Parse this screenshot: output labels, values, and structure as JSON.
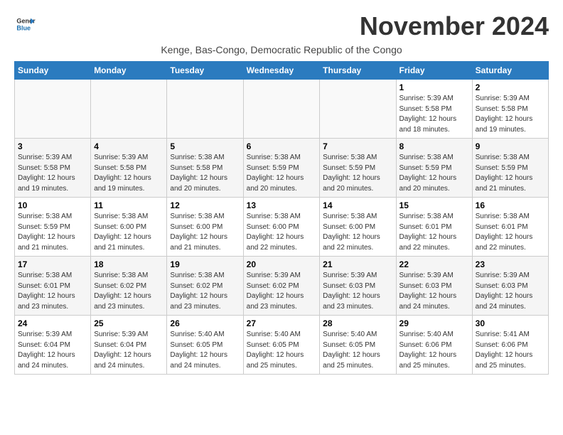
{
  "logo": {
    "line1": "General",
    "line2": "Blue"
  },
  "title": "November 2024",
  "subtitle": "Kenge, Bas-Congo, Democratic Republic of the Congo",
  "days_of_week": [
    "Sunday",
    "Monday",
    "Tuesday",
    "Wednesday",
    "Thursday",
    "Friday",
    "Saturday"
  ],
  "weeks": [
    [
      {
        "day": "",
        "info": ""
      },
      {
        "day": "",
        "info": ""
      },
      {
        "day": "",
        "info": ""
      },
      {
        "day": "",
        "info": ""
      },
      {
        "day": "",
        "info": ""
      },
      {
        "day": "1",
        "info": "Sunrise: 5:39 AM\nSunset: 5:58 PM\nDaylight: 12 hours\nand 18 minutes."
      },
      {
        "day": "2",
        "info": "Sunrise: 5:39 AM\nSunset: 5:58 PM\nDaylight: 12 hours\nand 19 minutes."
      }
    ],
    [
      {
        "day": "3",
        "info": "Sunrise: 5:39 AM\nSunset: 5:58 PM\nDaylight: 12 hours\nand 19 minutes."
      },
      {
        "day": "4",
        "info": "Sunrise: 5:39 AM\nSunset: 5:58 PM\nDaylight: 12 hours\nand 19 minutes."
      },
      {
        "day": "5",
        "info": "Sunrise: 5:38 AM\nSunset: 5:58 PM\nDaylight: 12 hours\nand 20 minutes."
      },
      {
        "day": "6",
        "info": "Sunrise: 5:38 AM\nSunset: 5:59 PM\nDaylight: 12 hours\nand 20 minutes."
      },
      {
        "day": "7",
        "info": "Sunrise: 5:38 AM\nSunset: 5:59 PM\nDaylight: 12 hours\nand 20 minutes."
      },
      {
        "day": "8",
        "info": "Sunrise: 5:38 AM\nSunset: 5:59 PM\nDaylight: 12 hours\nand 20 minutes."
      },
      {
        "day": "9",
        "info": "Sunrise: 5:38 AM\nSunset: 5:59 PM\nDaylight: 12 hours\nand 21 minutes."
      }
    ],
    [
      {
        "day": "10",
        "info": "Sunrise: 5:38 AM\nSunset: 5:59 PM\nDaylight: 12 hours\nand 21 minutes."
      },
      {
        "day": "11",
        "info": "Sunrise: 5:38 AM\nSunset: 6:00 PM\nDaylight: 12 hours\nand 21 minutes."
      },
      {
        "day": "12",
        "info": "Sunrise: 5:38 AM\nSunset: 6:00 PM\nDaylight: 12 hours\nand 21 minutes."
      },
      {
        "day": "13",
        "info": "Sunrise: 5:38 AM\nSunset: 6:00 PM\nDaylight: 12 hours\nand 22 minutes."
      },
      {
        "day": "14",
        "info": "Sunrise: 5:38 AM\nSunset: 6:00 PM\nDaylight: 12 hours\nand 22 minutes."
      },
      {
        "day": "15",
        "info": "Sunrise: 5:38 AM\nSunset: 6:01 PM\nDaylight: 12 hours\nand 22 minutes."
      },
      {
        "day": "16",
        "info": "Sunrise: 5:38 AM\nSunset: 6:01 PM\nDaylight: 12 hours\nand 22 minutes."
      }
    ],
    [
      {
        "day": "17",
        "info": "Sunrise: 5:38 AM\nSunset: 6:01 PM\nDaylight: 12 hours\nand 23 minutes."
      },
      {
        "day": "18",
        "info": "Sunrise: 5:38 AM\nSunset: 6:02 PM\nDaylight: 12 hours\nand 23 minutes."
      },
      {
        "day": "19",
        "info": "Sunrise: 5:38 AM\nSunset: 6:02 PM\nDaylight: 12 hours\nand 23 minutes."
      },
      {
        "day": "20",
        "info": "Sunrise: 5:39 AM\nSunset: 6:02 PM\nDaylight: 12 hours\nand 23 minutes."
      },
      {
        "day": "21",
        "info": "Sunrise: 5:39 AM\nSunset: 6:03 PM\nDaylight: 12 hours\nand 23 minutes."
      },
      {
        "day": "22",
        "info": "Sunrise: 5:39 AM\nSunset: 6:03 PM\nDaylight: 12 hours\nand 24 minutes."
      },
      {
        "day": "23",
        "info": "Sunrise: 5:39 AM\nSunset: 6:03 PM\nDaylight: 12 hours\nand 24 minutes."
      }
    ],
    [
      {
        "day": "24",
        "info": "Sunrise: 5:39 AM\nSunset: 6:04 PM\nDaylight: 12 hours\nand 24 minutes."
      },
      {
        "day": "25",
        "info": "Sunrise: 5:39 AM\nSunset: 6:04 PM\nDaylight: 12 hours\nand 24 minutes."
      },
      {
        "day": "26",
        "info": "Sunrise: 5:40 AM\nSunset: 6:05 PM\nDaylight: 12 hours\nand 24 minutes."
      },
      {
        "day": "27",
        "info": "Sunrise: 5:40 AM\nSunset: 6:05 PM\nDaylight: 12 hours\nand 25 minutes."
      },
      {
        "day": "28",
        "info": "Sunrise: 5:40 AM\nSunset: 6:05 PM\nDaylight: 12 hours\nand 25 minutes."
      },
      {
        "day": "29",
        "info": "Sunrise: 5:40 AM\nSunset: 6:06 PM\nDaylight: 12 hours\nand 25 minutes."
      },
      {
        "day": "30",
        "info": "Sunrise: 5:41 AM\nSunset: 6:06 PM\nDaylight: 12 hours\nand 25 minutes."
      }
    ]
  ]
}
